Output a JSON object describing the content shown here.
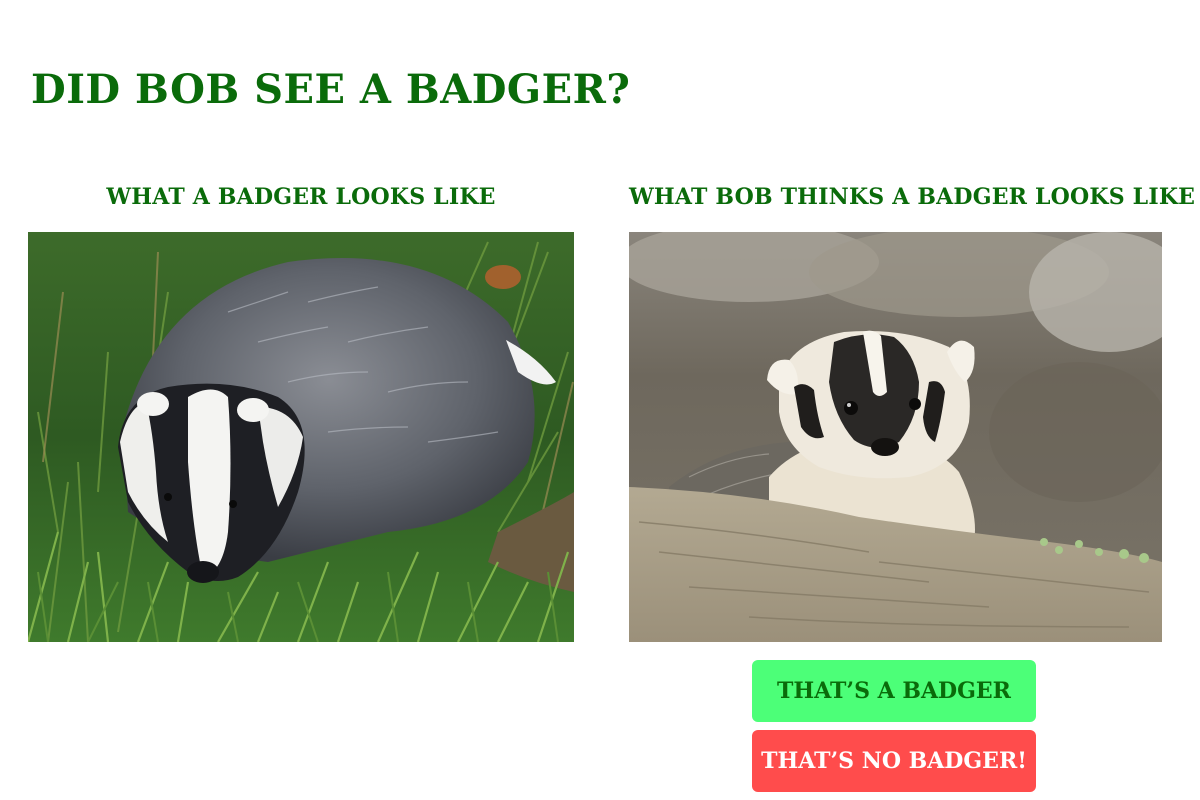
{
  "page": {
    "title": "DID BOB SEE A BADGER?"
  },
  "reference": {
    "heading": "WHAT A BADGER LOOKS LIKE",
    "image_subject": "european-badger-in-grass"
  },
  "bob": {
    "heading": "WHAT BOB THINKS A BADGER LOOKS LIKE",
    "image_subject": "american-badger-behind-log"
  },
  "actions": {
    "yes_label": "THAT’S A BADGER",
    "no_label": "THAT’S NO BADGER!"
  },
  "colors": {
    "heading_green": "#0a6b0a",
    "yes_button": "#4cff78",
    "no_button": "#ff4c4c"
  }
}
